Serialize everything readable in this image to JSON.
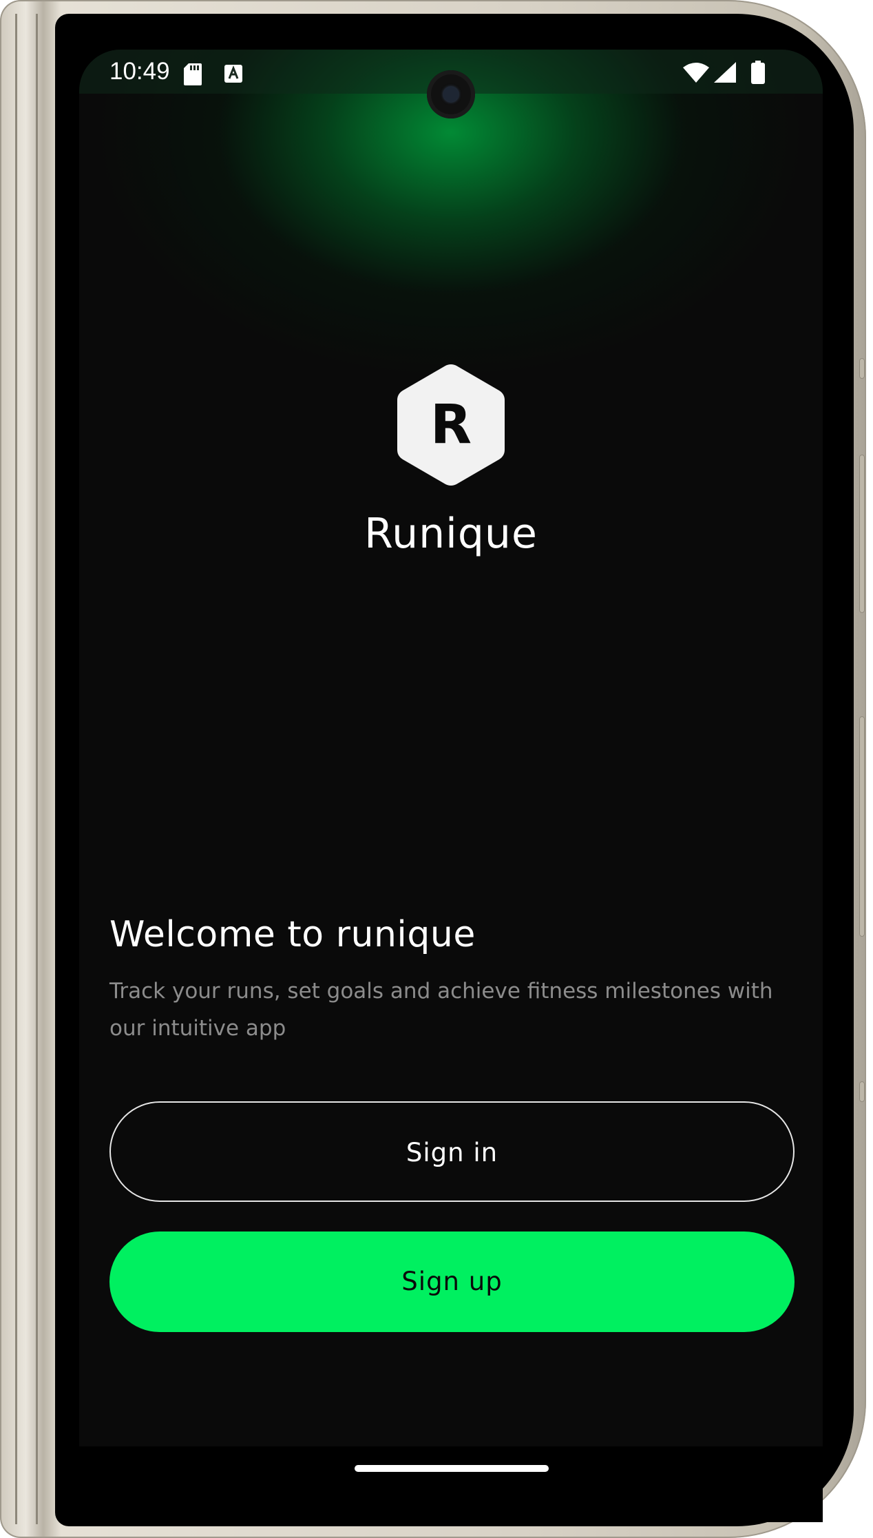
{
  "status_bar": {
    "time": "10:49",
    "icons": [
      "sd-card-icon",
      "text-a-icon",
      "wifi-icon",
      "signal-icon",
      "battery-icon"
    ]
  },
  "brand": {
    "logo_letter": "R",
    "app_name": "Runique",
    "accent_color": "#00f060",
    "background_color": "#0a0a0a"
  },
  "welcome": {
    "title": "Welcome to runique",
    "description": "Track your runs, set goals and achieve fitness milestones with our intuitive app"
  },
  "actions": {
    "sign_in_label": "Sign in",
    "sign_up_label": "Sign up"
  }
}
